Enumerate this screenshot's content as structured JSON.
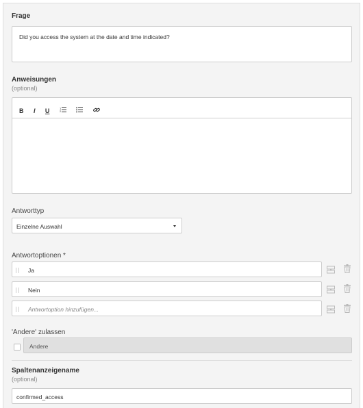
{
  "question": {
    "label": "Frage",
    "value": "Did you access the system at the date and time indicated?"
  },
  "instructions": {
    "label": "Anweisungen",
    "hint": "(optional)",
    "toolbar": [
      {
        "name": "bold-icon",
        "glyph": "B"
      },
      {
        "name": "italic-icon",
        "glyph": "I"
      },
      {
        "name": "underline-icon",
        "glyph": "U"
      },
      {
        "name": "ordered-list-icon",
        "glyph": "☰"
      },
      {
        "name": "bullet-list-icon",
        "glyph": "☰"
      },
      {
        "name": "link-icon",
        "glyph": "🔗"
      }
    ]
  },
  "answer_type": {
    "label": "Antworttyp",
    "selected": "Einzelne Auswahl"
  },
  "answer_options": {
    "label": "Antwortoptionen *",
    "items": [
      {
        "value": "Ja"
      },
      {
        "value": "Nein"
      }
    ],
    "add_placeholder": "Antwortoption hinzufügen..."
  },
  "allow_other": {
    "label": "'Andere' zulassen",
    "value": "Andere"
  },
  "column_name": {
    "label": "Spaltenanzeigename",
    "hint": "(optional)",
    "value": "confirmed_access"
  },
  "colors": {
    "panel_bg": "#f4f4f4",
    "border": "#cccccc",
    "disabled_bg": "#e0e0e0"
  }
}
